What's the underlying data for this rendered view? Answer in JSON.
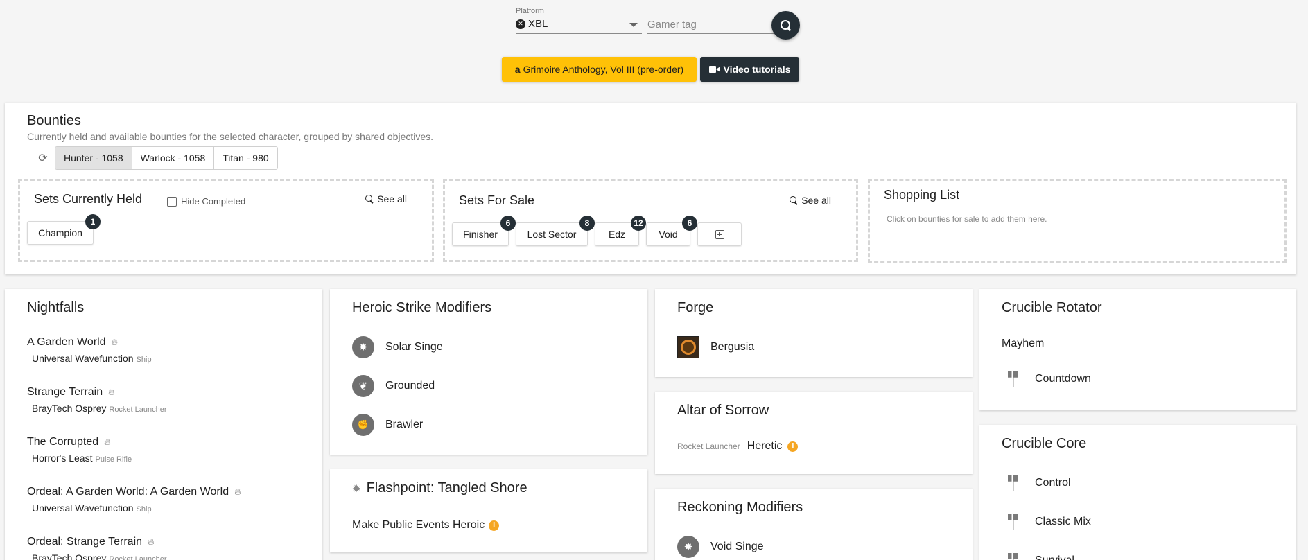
{
  "header": {
    "platform_label": "Platform",
    "platform_value": "XBL",
    "gamertag_placeholder": "Gamer tag",
    "amazon_button": "Grimoire Anthology, Vol III (pre-order)",
    "video_button": "Video tutorials"
  },
  "bounties": {
    "title": "Bounties",
    "description": "Currently held and available bounties for the selected character, grouped by shared objectives.",
    "characters": [
      {
        "label": "Hunter - 1058",
        "active": true
      },
      {
        "label": "Warlock - 1058",
        "active": false
      },
      {
        "label": "Titan - 980",
        "active": false
      }
    ],
    "held": {
      "title": "Sets Currently Held",
      "hide_completed": "Hide Completed",
      "see_all": "See all",
      "chips": [
        {
          "label": "Champion",
          "count": "1"
        }
      ]
    },
    "sale": {
      "title": "Sets For Sale",
      "see_all": "See all",
      "chips": [
        {
          "label": "Finisher",
          "count": "6"
        },
        {
          "label": "Lost Sector",
          "count": "8"
        },
        {
          "label": "Edz",
          "count": "12"
        },
        {
          "label": "Void",
          "count": "6"
        }
      ]
    },
    "shopping": {
      "title": "Shopping List",
      "hint": "Click on bounties for sale to add them here."
    }
  },
  "nightfalls": {
    "title": "Nightfalls",
    "items": [
      {
        "name": "A Garden World",
        "reward": "Universal Wavefunction",
        "type": "Ship"
      },
      {
        "name": "Strange Terrain",
        "reward": "BrayTech Osprey",
        "type": "Rocket Launcher"
      },
      {
        "name": "The Corrupted",
        "reward": "Horror's Least",
        "type": "Pulse Rifle"
      },
      {
        "name": "Ordeal: A Garden World: A Garden World",
        "reward": "Universal Wavefunction",
        "type": "Ship"
      },
      {
        "name": "Ordeal: Strange Terrain",
        "reward": "BrayTech Osprey",
        "type": "Rocket Launcher"
      }
    ]
  },
  "heroic": {
    "title": "Heroic Strike Modifiers",
    "items": [
      "Solar Singe",
      "Grounded",
      "Brawler"
    ]
  },
  "flashpoint": {
    "title": "Flashpoint: Tangled Shore",
    "item": "Make Public Events Heroic"
  },
  "forge": {
    "title": "Forge",
    "item": "Bergusia"
  },
  "altar": {
    "title": "Altar of Sorrow",
    "type": "Rocket Launcher",
    "item": "Heretic"
  },
  "reckoning": {
    "title": "Reckoning Modifiers",
    "item": "Void Singe"
  },
  "rotator": {
    "title": "Crucible Rotator",
    "mode": "Mayhem",
    "item": "Countdown"
  },
  "core": {
    "title": "Crucible Core",
    "items": [
      "Control",
      "Classic Mix",
      "Survival"
    ]
  },
  "colors": {
    "accent_dark": "#252f36",
    "accent_yellow": "#ffc107",
    "info_orange": "#f5a623"
  }
}
